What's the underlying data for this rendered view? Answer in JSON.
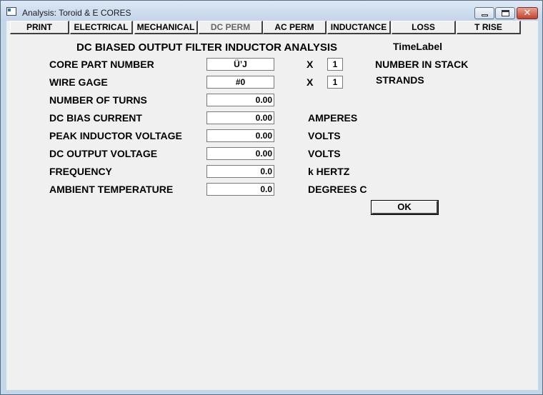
{
  "window": {
    "title": "Analysis: Toroid & E CORES"
  },
  "tabs": [
    {
      "label": "PRINT"
    },
    {
      "label": "ELECTRICAL"
    },
    {
      "label": "MECHANICAL"
    },
    {
      "label": "DC PERM"
    },
    {
      "label": "AC PERM"
    },
    {
      "label": "INDUCTANCE"
    },
    {
      "label": "LOSS"
    },
    {
      "label": "T RISE"
    }
  ],
  "main": {
    "heading": "DC BIASED OUTPUT FILTER INDUCTOR ANALYSIS",
    "time_label": "TimeLabel",
    "fields": {
      "core_part_number": {
        "label": "CORE PART NUMBER",
        "value": "Ü’J"
      },
      "wire_gage": {
        "label": "WIRE GAGE",
        "value": "#0"
      },
      "number_of_turns": {
        "label": "NUMBER OF TURNS",
        "value": "0.00"
      },
      "dc_bias_current": {
        "label": "DC BIAS CURRENT",
        "value": "0.00",
        "unit": "AMPERES"
      },
      "peak_inductor_voltage": {
        "label": "PEAK INDUCTOR VOLTAGE",
        "value": "0.00",
        "unit": "VOLTS"
      },
      "dc_output_voltage": {
        "label": "DC OUTPUT VOLTAGE",
        "value": "0.00",
        "unit": "VOLTS"
      },
      "frequency": {
        "label": "FREQUENCY",
        "value": "0.0",
        "unit": "k HERTZ"
      },
      "ambient_temperature": {
        "label": "AMBIENT TEMPERATURE",
        "value": "0.0",
        "unit": "DEGREES C"
      }
    },
    "stack": {
      "x": "X",
      "value": "1",
      "label": "NUMBER IN STACK"
    },
    "strands": {
      "x": "X",
      "value": "1",
      "label": "STRANDS"
    },
    "ok_label": "OK"
  }
}
